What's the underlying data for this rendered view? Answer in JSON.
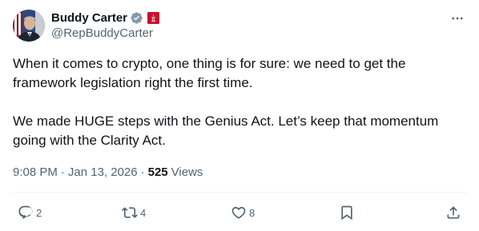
{
  "author": {
    "display_name": "Buddy Carter",
    "handle": "@RepBuddyCarter",
    "verified_icon": "verified-badge-icon",
    "affiliation_icon": "us-house-flag-icon"
  },
  "tweet": {
    "paragraphs": [
      "When it comes to crypto, one thing is for sure: we need to get the framework legislation right the first time.",
      "We made HUGE steps with the Genius Act. Let’s keep that momentum going with the Clarity Act."
    ]
  },
  "meta": {
    "time": "9:08 PM",
    "separator": "·",
    "date": "Jan 13, 2026",
    "views_count": "525",
    "views_label": "Views"
  },
  "actions": {
    "replies": "2",
    "reposts": "4",
    "likes": "8"
  },
  "colors": {
    "text": "#0f1419",
    "secondary": "#536471",
    "verified": "#829aab",
    "flag": "#c8102e",
    "divider": "#eff3f4"
  }
}
